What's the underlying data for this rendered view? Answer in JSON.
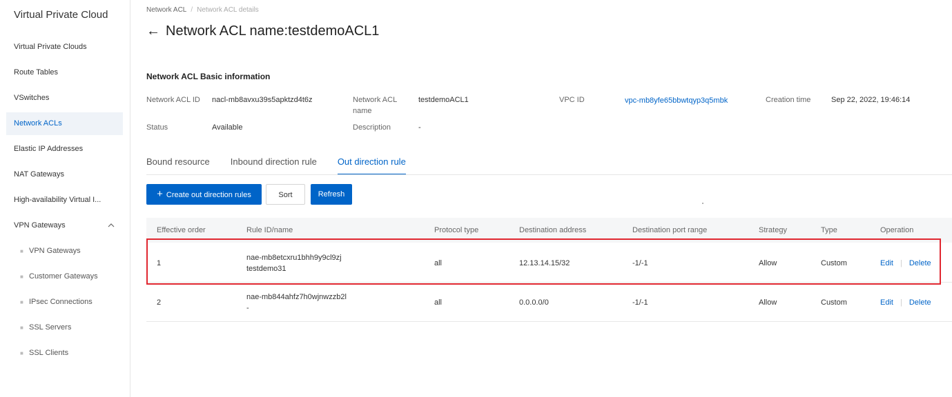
{
  "sidebar": {
    "title": "Virtual Private Cloud",
    "items": [
      {
        "label": "Virtual Private Clouds"
      },
      {
        "label": "Route Tables"
      },
      {
        "label": "VSwitches"
      },
      {
        "label": "Network ACLs"
      },
      {
        "label": "Elastic IP Addresses"
      },
      {
        "label": "NAT Gateways"
      },
      {
        "label": "High-availability Virtual I..."
      },
      {
        "label": "VPN Gateways"
      }
    ],
    "vpn_sub": [
      {
        "label": "VPN Gateways"
      },
      {
        "label": "Customer Gateways"
      },
      {
        "label": "IPsec Connections"
      },
      {
        "label": "SSL Servers"
      },
      {
        "label": "SSL Clients"
      }
    ]
  },
  "breadcrumb": {
    "parent": "Network ACL",
    "separator": "/",
    "current": "Network ACL details"
  },
  "page": {
    "title": "Network ACL name:testdemoACL1",
    "back_icon": "←"
  },
  "basic_info": {
    "title": "Network ACL Basic information",
    "acl_id_label": "Network ACL ID",
    "acl_id_value": "nacl-mb8avxu39s5apktzd4t6z",
    "acl_name_label_1": "Network ACL",
    "acl_name_label_2": "name",
    "acl_name_value": "testdemoACL1",
    "vpc_id_label": "VPC ID",
    "vpc_id_value": "vpc-mb8yfe65bbwtqyp3q5mbk",
    "creation_label": "Creation time",
    "creation_value": "Sep 22, 2022, 19:46:14",
    "status_label": "Status",
    "status_value": "Available",
    "description_label": "Description",
    "description_value": "-"
  },
  "tabs": [
    {
      "label": "Bound resource"
    },
    {
      "label": "Inbound direction rule"
    },
    {
      "label": "Out direction rule"
    }
  ],
  "toolbar": {
    "create_icon": "+",
    "create_label": "Create out direction rules",
    "sort_label": "Sort",
    "refresh_label": "Refresh"
  },
  "table": {
    "columns": [
      "Effective order",
      "Rule ID/name",
      "Protocol type",
      "Destination address",
      "Destination port range",
      "Strategy",
      "Type",
      "Operation"
    ],
    "rows": [
      {
        "order": "1",
        "rule_id": "nae-mb8etcxru1bhh9y9cl9zj",
        "rule_name": "testdemo31",
        "protocol": "all",
        "destination": "12.13.14.15/32",
        "port_range": "-1/-1",
        "strategy": "Allow",
        "type": "Custom",
        "edit": "Edit",
        "sep": "|",
        "delete": "Delete"
      },
      {
        "order": "2",
        "rule_id": "nae-mb844ahfz7h0wjnwzzb2l",
        "rule_name": "-",
        "protocol": "all",
        "destination": "0.0.0.0/0",
        "port_range": "-1/-1",
        "strategy": "Allow",
        "type": "Custom",
        "edit": "Edit",
        "sep": "|",
        "delete": "Delete"
      }
    ]
  },
  "colors": {
    "accent": "#0064c8",
    "highlight": "#e0262f"
  }
}
